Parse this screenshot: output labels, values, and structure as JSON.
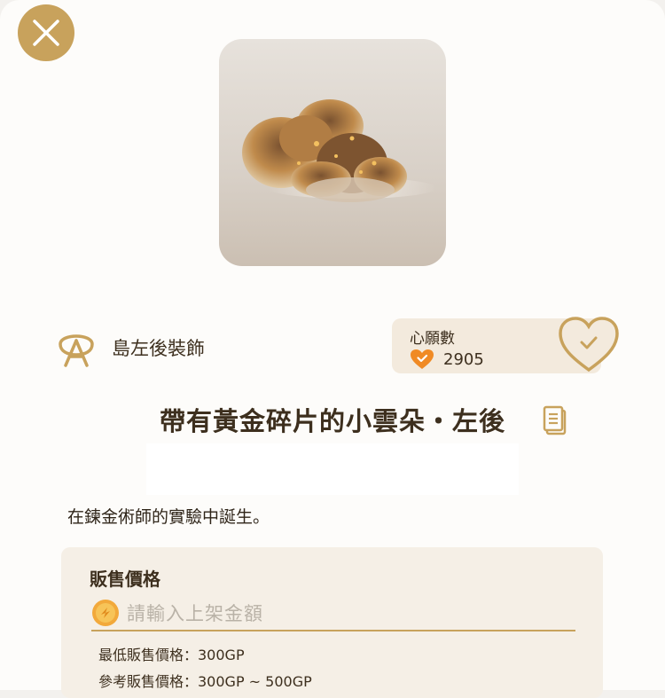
{
  "header": {
    "close_icon": "close-icon"
  },
  "item": {
    "image_icon": "golden-cloud-image",
    "category_icon": "hanger-icon",
    "category": "島左後裝飾",
    "name": "帶有黃金碎片的小雲朵・左後",
    "description": "在鍊金術師的實驗中誕生。"
  },
  "wish": {
    "title": "心願數",
    "count": "2905",
    "badge_icon": "heart-check-icon",
    "button_icon": "heart-check-outline-icon"
  },
  "price": {
    "title": "販售價格",
    "coin_icon": "gold-coin-icon",
    "placeholder": "請輸入上架金額",
    "min_label": "最低販售價格：300GP",
    "ref_label": "參考販售價格：300GP ~ 500GP"
  },
  "colors": {
    "accent": "#c8a25c",
    "text": "#3d2f1e",
    "orange": "#f08a24"
  }
}
